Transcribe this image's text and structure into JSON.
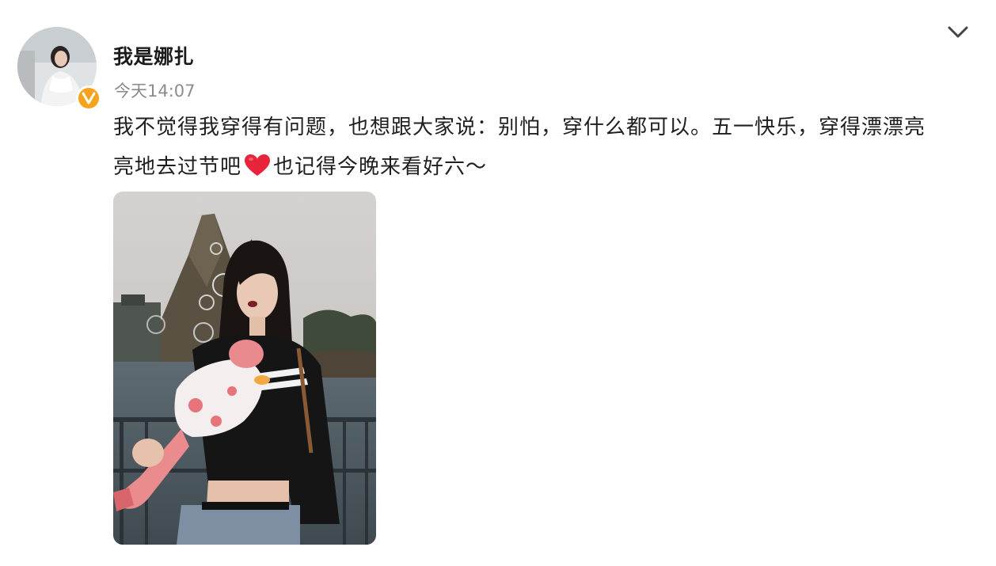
{
  "post": {
    "author_name": "我是娜扎",
    "timestamp": "今天14:07",
    "text_line1": "我不觉得我穿得有问题，也想跟大家说：别怕，穿什么都可以。五一快乐，穿得漂漂亮",
    "text_line2_before_emoji": "亮地去过节吧",
    "emoji": "heart-emoji",
    "text_line2_after_emoji": "也记得今晚来看好六～"
  },
  "icons": {
    "menu": "chevron-down-icon",
    "verified": "verified-badge-icon"
  },
  "colors": {
    "verified_badge": "#f7a21b",
    "timestamp": "#8c8c8c",
    "heart": "#e8243b"
  }
}
